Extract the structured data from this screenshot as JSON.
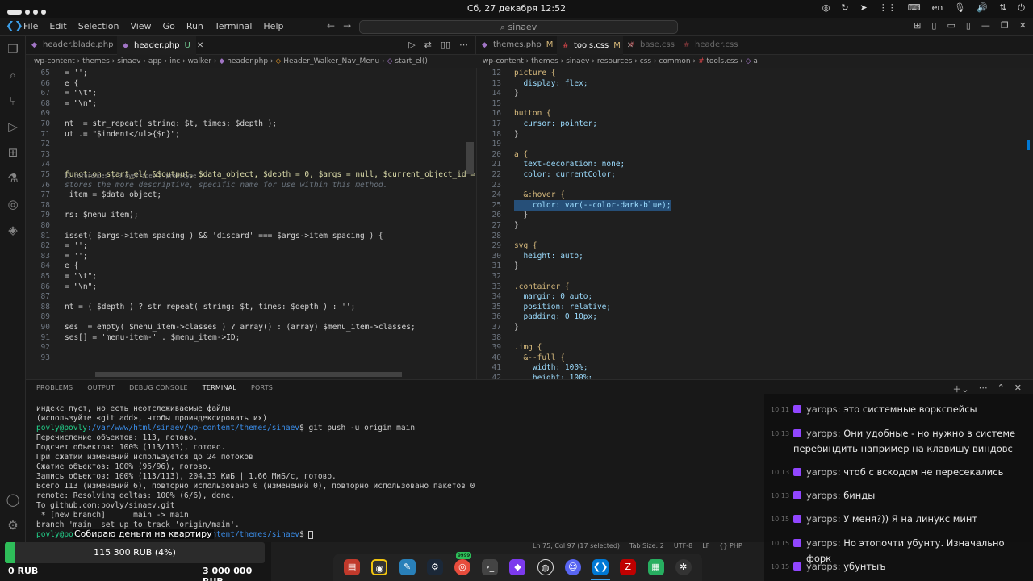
{
  "system_bar": {
    "clock": "Сб, 27 декабря 12:52",
    "language": "en"
  },
  "menubar": {
    "items": [
      "File",
      "Edit",
      "Selection",
      "View",
      "Go",
      "Run",
      "Terminal",
      "Help"
    ],
    "search_text": "sinaev"
  },
  "left_editor": {
    "tabs": [
      {
        "label": "header.blade.php",
        "status": "M",
        "active": false
      },
      {
        "label": "header.php",
        "status": "U",
        "active": true
      }
    ],
    "breadcrumb": [
      "wp-content",
      "themes",
      "sinaev",
      "app",
      "inc",
      "walker",
      "header.php",
      "Header_Walker_Nav_Menu",
      "start_el()"
    ],
    "codelens": "11 references | 0 overrides | prototype",
    "lines": [
      {
        "n": "65",
        "code": "= '';"
      },
      {
        "n": "66",
        "code": "e {"
      },
      {
        "n": "67",
        "code": "= \"\\t\";"
      },
      {
        "n": "68",
        "code": "= \"\\n\";"
      },
      {
        "n": "69",
        "code": ""
      },
      {
        "n": "70",
        "code": "nt  = str_repeat( string: $t, times: $depth );"
      },
      {
        "n": "71",
        "code": "ut .= \"$indent</ul>{$n}\";"
      },
      {
        "n": "72",
        "code": ""
      },
      {
        "n": "73",
        "code": ""
      },
      {
        "n": "74",
        "code": ""
      },
      {
        "n": "75",
        "code": "function start_el( &$output, $data_object, $depth = 0, $args = null, $current_object_id ="
      },
      {
        "n": "76",
        "code": "stores the more descriptive, specific name for use within this method."
      },
      {
        "n": "77",
        "code": "_item = $data_object;"
      },
      {
        "n": "78",
        "code": ""
      },
      {
        "n": "79",
        "code": "rs: $menu_item);"
      },
      {
        "n": "80",
        "code": ""
      },
      {
        "n": "81",
        "code": "isset( $args->item_spacing ) && 'discard' === $args->item_spacing ) {"
      },
      {
        "n": "82",
        "code": "= '';"
      },
      {
        "n": "83",
        "code": "= '';"
      },
      {
        "n": "84",
        "code": "e {"
      },
      {
        "n": "85",
        "code": "= \"\\t\";"
      },
      {
        "n": "86",
        "code": "= \"\\n\";"
      },
      {
        "n": "87",
        "code": ""
      },
      {
        "n": "88",
        "code": "nt = ( $depth ) ? str_repeat( string: $t, times: $depth ) : '';"
      },
      {
        "n": "89",
        "code": ""
      },
      {
        "n": "90",
        "code": "ses  = empty( $menu_item->classes ) ? array() : (array) $menu_item->classes;"
      },
      {
        "n": "91",
        "code": "ses[] = 'menu-item-' . $menu_item->ID;"
      },
      {
        "n": "92",
        "code": ""
      },
      {
        "n": "93",
        "code": ""
      }
    ]
  },
  "right_editor": {
    "tabs": [
      {
        "label": "themes.php",
        "status": "M",
        "active": false
      },
      {
        "label": "tools.css",
        "status": "M",
        "active": true
      },
      {
        "label": "base.css",
        "status": "",
        "active": false
      },
      {
        "label": "header.css",
        "status": "",
        "active": false
      }
    ],
    "breadcrumb": [
      "wp-content",
      "themes",
      "sinaev",
      "resources",
      "css",
      "common",
      "tools.css",
      "a"
    ],
    "lines": [
      {
        "n": "12",
        "code": "picture {"
      },
      {
        "n": "13",
        "code": "  display: flex;"
      },
      {
        "n": "14",
        "code": "}"
      },
      {
        "n": "15",
        "code": ""
      },
      {
        "n": "16",
        "code": "button {"
      },
      {
        "n": "17",
        "code": "  cursor: pointer;"
      },
      {
        "n": "18",
        "code": "}"
      },
      {
        "n": "19",
        "code": ""
      },
      {
        "n": "20",
        "code": "a {"
      },
      {
        "n": "21",
        "code": "  text-decoration: none;"
      },
      {
        "n": "22",
        "code": "  color: currentColor;"
      },
      {
        "n": "23",
        "code": ""
      },
      {
        "n": "24",
        "code": "  &:hover {"
      },
      {
        "n": "25",
        "code": "    color: var(--color-dark-blue);"
      },
      {
        "n": "26",
        "code": "  }"
      },
      {
        "n": "27",
        "code": "}"
      },
      {
        "n": "28",
        "code": ""
      },
      {
        "n": "29",
        "code": "svg {"
      },
      {
        "n": "30",
        "code": "  height: auto;"
      },
      {
        "n": "31",
        "code": "}"
      },
      {
        "n": "32",
        "code": ""
      },
      {
        "n": "33",
        "code": ".container {"
      },
      {
        "n": "34",
        "code": "  margin: 0 auto;"
      },
      {
        "n": "35",
        "code": "  position: relative;"
      },
      {
        "n": "36",
        "code": "  padding: 0 10px;"
      },
      {
        "n": "37",
        "code": "}"
      },
      {
        "n": "38",
        "code": ""
      },
      {
        "n": "39",
        "code": ".img {"
      },
      {
        "n": "40",
        "code": "  &--full {"
      },
      {
        "n": "41",
        "code": "    width: 100%;"
      },
      {
        "n": "42",
        "code": "    height: 100%;"
      }
    ]
  },
  "panel": {
    "tabs": [
      "PROBLEMS",
      "OUTPUT",
      "DEBUG CONSOLE",
      "TERMINAL",
      "PORTS"
    ],
    "active_tab": "TERMINAL",
    "terminal_lines": [
      "индекс пуст, но есть неотслеживаемые файлы",
      "(используйте «git add», чтобы проиндексировать их)",
      "povly@povly:/var/www/html/sinaev/wp-content/themes/sinaev$ git push -u origin main",
      "Перечисление объектов: 113, готово.",
      "Подсчет объектов: 100% (113/113), готово.",
      "При сжатии изменений используется до 24 потоков",
      "Сжатие объектов: 100% (96/96), готово.",
      "Запись объектов: 100% (113/113), 204.33 КиБ | 1.66 МиБ/с, готово.",
      "Всего 113 (изменений 6), повторно использовано 0 (изменений 0), повторно использовано пакетов 0",
      "remote: Resolving deltas: 100% (6/6), done.",
      "To github.com:povly/sinaev.git",
      " * [new branch]      main -> main",
      "branch 'main' set up to track 'origin/main'.",
      "povly@povly:/var/www/html/sinaev/wp-content/themes/sinaev$ "
    ],
    "prompt_user": "povly@povly",
    "prompt_path": ":/var/www/html/sinaev/wp-content/themes/sinaev",
    "command": "git push -u origin main"
  },
  "statusbar": {
    "position": "Ln 75, Col 97 (17 selected)",
    "indent": "Tab Size: 2",
    "encoding": "UTF-8",
    "eol": "LF",
    "language": "PHP"
  },
  "chat": {
    "messages": [
      {
        "time": "10:11",
        "user": "yarops",
        "text": "это системные воркспейсы"
      },
      {
        "time": "10:13",
        "user": "yarops",
        "text": "Они удобные - но нужно в системе перебиндить например на клавишу виндовс"
      },
      {
        "time": "10:13",
        "user": "yarops",
        "text": "чтоб с вскодом не пересекались"
      },
      {
        "time": "10:13",
        "user": "yarops",
        "text": "бинды"
      },
      {
        "time": "10:15",
        "user": "yarops",
        "text": "У меня?)) Я на линукс минт"
      },
      {
        "time": "10:15",
        "user": "yarops",
        "text": "Но этопочти убунту. Изначально форк"
      },
      {
        "time": "10:15",
        "user": "yarops",
        "text": "убунтыъ"
      }
    ]
  },
  "donation": {
    "title": "Собираю деньги на квартиру",
    "current": "115 300 RUB (4%)",
    "progress": 0.04,
    "min": "0 RUB",
    "max": "3 000 000 RUB"
  },
  "dock": {
    "apps": [
      "files-icon",
      "camera-icon",
      "text-editor-icon",
      "steam-icon",
      "chrome-icon",
      "terminal-icon",
      "obsidian-icon",
      "obs-icon",
      "discord-icon",
      "vscode-icon",
      "filezilla-icon",
      "archive-icon",
      "settings-icon"
    ],
    "chrome_badge": "9999"
  },
  "colors": {
    "accent": "#0078d4",
    "progress_fill": "#2ebd59",
    "twitch_purple": "#9146ff"
  }
}
